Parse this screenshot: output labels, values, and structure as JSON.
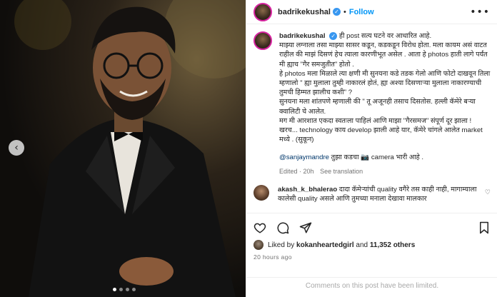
{
  "post": {
    "username": "badrikekushal",
    "follow_label": "Follow",
    "separator": "•",
    "more_label": "•••"
  },
  "caption": {
    "username": "badrikekushal",
    "text": "ही post सत्य घटने वर आधारित आहे.\nमाझ्या लग्नाला तसा माझ्या सासर कडून, कडकडून विरोध होता. मला कायम असं वाटत राहील की माझं दिसणं हेच त्याला कारणीभूत असेल . आता हे photos हाती लागे पर्यंत मी ह्याच \"गैर समजुतीत\" होतो .\nहे photos मला मिळाले त्या क्षणी मी सुनयना कडे तडक गेलो आणि फोटो दाखवून तिला म्हणालो \" ह्या मुलाला तुम्ही नाकारलं होतं, ह्या अश्या दिसणाऱ्या मुलाला नाकारण्याची तुमची हिम्मत झालीच कशी\" ?\nसुनयना मला शांतपणे म्हणाली की \" तू अजूनही तसाच दिसतोस. हल्ली कॅमेरे बऱ्या क्वालिटी चे आलेत.\nमग मी आरशात एकदा स्वतःला पाहिलं आणि माझा \"गैरसमज\" संपूर्ण दूर झाला !\nखरच... technology काय develop झाली आहे यार, कॅमेरे चांगले आलेत market मध्ये . (सुकून)",
    "mention": "@sanjaymandre",
    "mention_tail": " तुझा कडचा 📷 camera भारी आहे .",
    "edited": "Edited · 20h",
    "see_translation": "See translation"
  },
  "comment": {
    "username": "akash_k_bhalerao",
    "text": " दादा कॅमेऱ्यांची quality वगैरे तस काही नाही, मागाम्याला कालेसी quality असले आणि तुमच्या मनाला देखावा मालकार"
  },
  "likes": {
    "prefix": "Liked by ",
    "user": "kokanheartedgirl",
    "middle": " and ",
    "others": "11,352 others"
  },
  "timestamp": "20 hours ago",
  "comments_limited": "Comments on this post have been limited.",
  "carousel": {
    "prev_label": "‹",
    "slides": 4,
    "active": 1
  }
}
